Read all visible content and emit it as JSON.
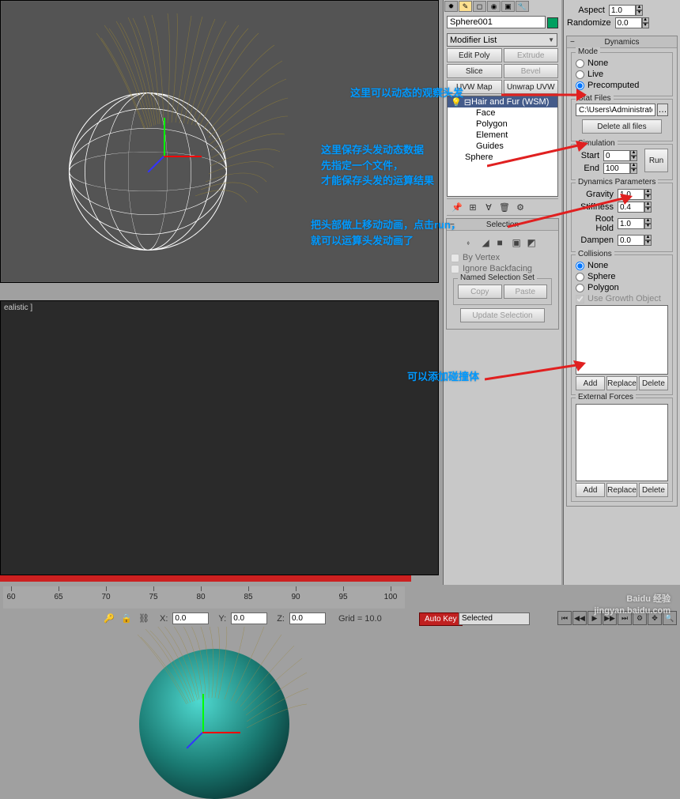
{
  "object_name": "Sphere001",
  "modifier_list_label": "Modifier List",
  "mod_buttons": {
    "edit_poly": "Edit Poly",
    "extrude": "Extrude",
    "slice": "Slice",
    "bevel": "Bevel",
    "uvw_map": "UVW Map",
    "unwrap": "Unwrap UVW"
  },
  "stack": [
    "Hair and Fur (WSM)",
    "Face",
    "Polygon",
    "Element",
    "Guides",
    "Sphere"
  ],
  "selection": {
    "title": "Selection",
    "by_vertex": "By Vertex",
    "ignore_backfacing": "Ignore Backfacing",
    "named_set": "Named Selection Set",
    "copy": "Copy",
    "paste": "Paste",
    "update": "Update Selection"
  },
  "aspect": {
    "label": "Aspect",
    "value": "1.0"
  },
  "randomize": {
    "label": "Randomize",
    "value": "0.0"
  },
  "dynamics": {
    "title": "Dynamics",
    "mode": {
      "title": "Mode",
      "none": "None",
      "live": "Live",
      "precomputed": "Precomputed",
      "selected": "precomputed"
    },
    "stat_files": {
      "title": "Stat Files",
      "path": "C:\\Users\\Administrator",
      "delete_all": "Delete all files"
    },
    "simulation": {
      "title": "Simulation",
      "start_label": "Start",
      "start": "0",
      "end_label": "End",
      "end": "100",
      "run": "Run"
    },
    "params": {
      "title": "Dynamics Parameters",
      "gravity": "Gravity",
      "gravity_v": "1.0",
      "stiffness": "Stiffness",
      "stiffness_v": "0.4",
      "root_hold": "Root Hold",
      "root_hold_v": "1.0",
      "dampen": "Dampen",
      "dampen_v": "0.0"
    },
    "collisions": {
      "title": "Collisions",
      "none": "None",
      "sphere": "Sphere",
      "polygon": "Polygon",
      "use_growth": "Use Growth Object",
      "add": "Add",
      "replace": "Replace",
      "delete": "Delete"
    },
    "external_forces": {
      "title": "External Forces",
      "add": "Add",
      "replace": "Replace",
      "delete": "Delete"
    }
  },
  "annotations": {
    "a1": "这里可以动态的观察头发",
    "a2": "这里保存头发动态数据\n先指定一个文件，\n才能保存头发的运算结果",
    "a3": "把头部做上移动动画，点击run，\n就可以运算头发动画了",
    "a4": "可以添加碰撞体"
  },
  "viewport_label": "ealistic ]",
  "coords": {
    "x_label": "X:",
    "x": "0.0",
    "y_label": "Y:",
    "y": "0.0",
    "z_label": "Z:",
    "z": "0.0",
    "grid": "Grid = 10.0"
  },
  "autokey": "Auto Key",
  "selected": "Selected",
  "ruler": [
    "60",
    "65",
    "70",
    "75",
    "80",
    "85",
    "90",
    "95",
    "100"
  ],
  "watermark": {
    "main": "Baidu 经验",
    "sub": "jingyan.baidu.com"
  }
}
